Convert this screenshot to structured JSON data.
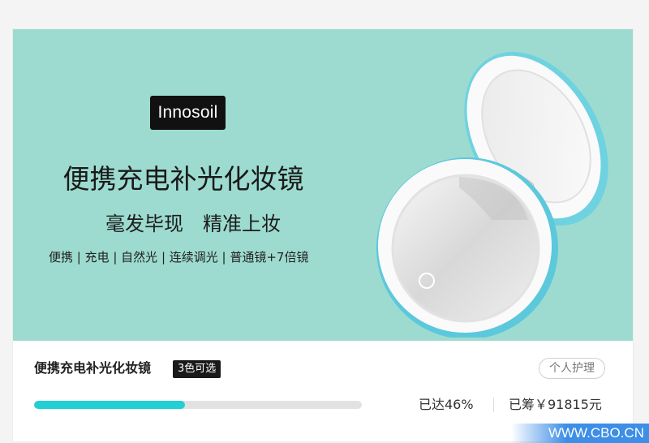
{
  "banner": {
    "brand": "Innosoil",
    "headline": "便携充电补光化妆镜",
    "tagline": "毫发毕现　精准上妆",
    "features": "便携 | 充电 | 自然光 | 连续调光 | 普通镜+7倍镜",
    "background_color": "#9ddbd0"
  },
  "product": {
    "title": "便携充电补光化妆镜",
    "badge": "3色可选",
    "category": "个人护理",
    "progress_percent": 46,
    "progress_text": "已达46%",
    "raised_text": "已筹￥91815元",
    "accent_color": "#22cfd4"
  },
  "watermark": "WWW.CBO.CN"
}
